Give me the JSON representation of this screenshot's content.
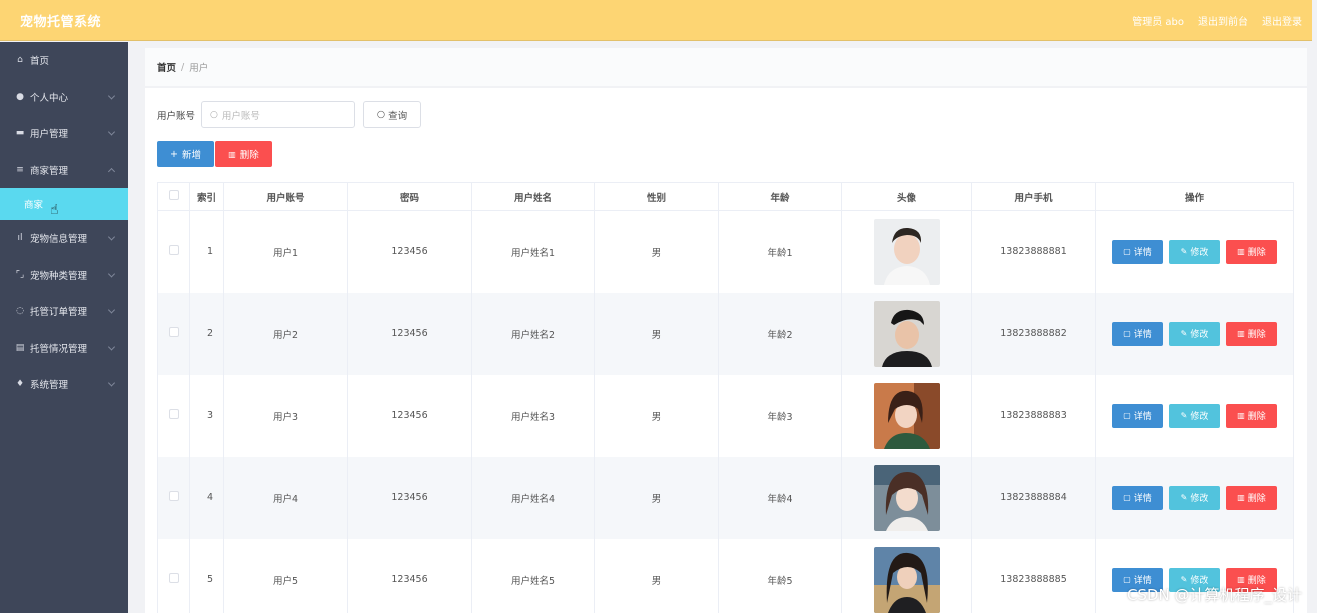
{
  "app": {
    "title": "宠物托管系统",
    "top_links": [
      "管理员 abo",
      "退出到前台",
      "退出登录"
    ]
  },
  "sidebar": {
    "items": [
      {
        "label": "首页",
        "icon": "home-icon",
        "glyph": "⌂"
      },
      {
        "label": "个人中心",
        "icon": "user-icon",
        "glyph": "●"
      },
      {
        "label": "用户管理",
        "icon": "chat-icon",
        "glyph": "▬"
      },
      {
        "label": "商家管理",
        "icon": "list-icon",
        "glyph": "≡"
      },
      {
        "label": "宠物信息管理",
        "icon": "bar-chart-icon",
        "glyph": "ıl"
      },
      {
        "label": "宠物种类管理",
        "icon": "frame-icon",
        "glyph": "⌜⌟"
      },
      {
        "label": "托管订单管理",
        "icon": "circle-icon",
        "glyph": "◌"
      },
      {
        "label": "托管情况管理",
        "icon": "document-icon",
        "glyph": "▤"
      },
      {
        "label": "系统管理",
        "icon": "location-icon",
        "glyph": "♦"
      }
    ],
    "expanded_sub": "商家"
  },
  "breadcrumb": {
    "home": "首页",
    "separator": "/",
    "current": "用户"
  },
  "search": {
    "label": "用户账号",
    "placeholder": "用户账号",
    "button": "查询"
  },
  "actions": {
    "add": "新增",
    "delete": "删除"
  },
  "table": {
    "columns": [
      "索引",
      "用户账号",
      "密码",
      "用户姓名",
      "性别",
      "年龄",
      "头像",
      "用户手机",
      "操作"
    ],
    "rows": [
      {
        "index": "1",
        "account": "用户1",
        "password": "123456",
        "name": "用户姓名1",
        "gender": "男",
        "age": "年龄1",
        "phone": "13823888881"
      },
      {
        "index": "2",
        "account": "用户2",
        "password": "123456",
        "name": "用户姓名2",
        "gender": "男",
        "age": "年龄2",
        "phone": "13823888882"
      },
      {
        "index": "3",
        "account": "用户3",
        "password": "123456",
        "name": "用户姓名3",
        "gender": "男",
        "age": "年龄3",
        "phone": "13823888883"
      },
      {
        "index": "4",
        "account": "用户4",
        "password": "123456",
        "name": "用户姓名4",
        "gender": "男",
        "age": "年龄4",
        "phone": "13823888884"
      },
      {
        "index": "5",
        "account": "用户5",
        "password": "123456",
        "name": "用户姓名5",
        "gender": "男",
        "age": "年龄5",
        "phone": "13823888885"
      }
    ],
    "row_ops": {
      "detail": "详情",
      "edit": "修改",
      "delete": "删除"
    }
  },
  "colors": {
    "topbar": "#fdd573",
    "sidebar": "#3e4659",
    "active_sub": "#5ad9ef",
    "primary": "#3e8ed3",
    "info": "#52c3dd",
    "danger": "#fb4f4f"
  },
  "watermark": "CSDN @计算机程序_设计"
}
